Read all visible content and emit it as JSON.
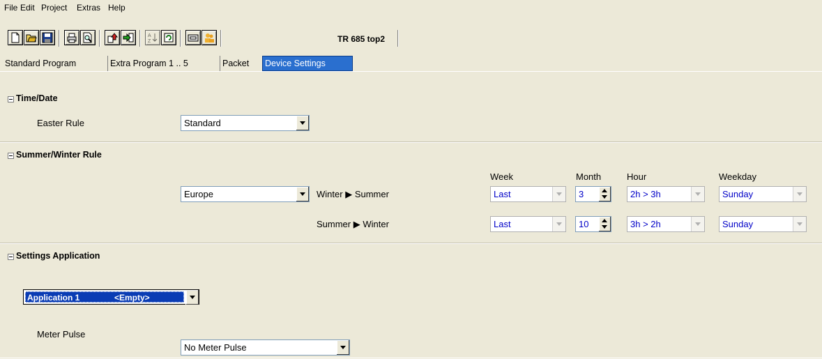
{
  "menu": [
    "File",
    "Edit",
    "Project",
    "Extras",
    "Help"
  ],
  "toolbar": {
    "title": "TR 685 top2",
    "icons": [
      "new-file-icon",
      "open-folder-icon",
      "save-icon",
      "print-icon",
      "print-preview-icon",
      "upload-icon",
      "download-icon",
      "sort-icon",
      "refresh-icon",
      "device-icon",
      "users-icon"
    ]
  },
  "tabs": [
    "Standard Program",
    "Extra Program 1 .. 5",
    "Packet",
    "Device Settings"
  ],
  "time_date": {
    "title": "Time/Date",
    "easter_label": "Easter Rule",
    "easter_value": "Standard"
  },
  "summer_winter": {
    "title": "Summer/Winter Rule",
    "region_value": "Europe",
    "headers": {
      "week": "Week",
      "month": "Month",
      "hour": "Hour",
      "weekday": "Weekday"
    },
    "rows": [
      {
        "label_from": "Winter",
        "label_to": "Summer",
        "week": "Last",
        "month": "3",
        "hour": "2h > 3h",
        "weekday": "Sunday"
      },
      {
        "label_from": "Summer",
        "label_to": "Winter",
        "week": "Last",
        "month": "10",
        "hour": "3h > 2h",
        "weekday": "Sunday"
      }
    ]
  },
  "settings_app": {
    "title": "Settings Application",
    "app_name": "Application 1",
    "app_value": "<Empty>",
    "meter_label": "Meter Pulse",
    "meter_value": "No Meter Pulse"
  },
  "colors": {
    "background": "#ece9d8",
    "active_tab": "#2a6fcf",
    "selection": "#0a3cb4",
    "disabled_text": "#0000c8"
  }
}
